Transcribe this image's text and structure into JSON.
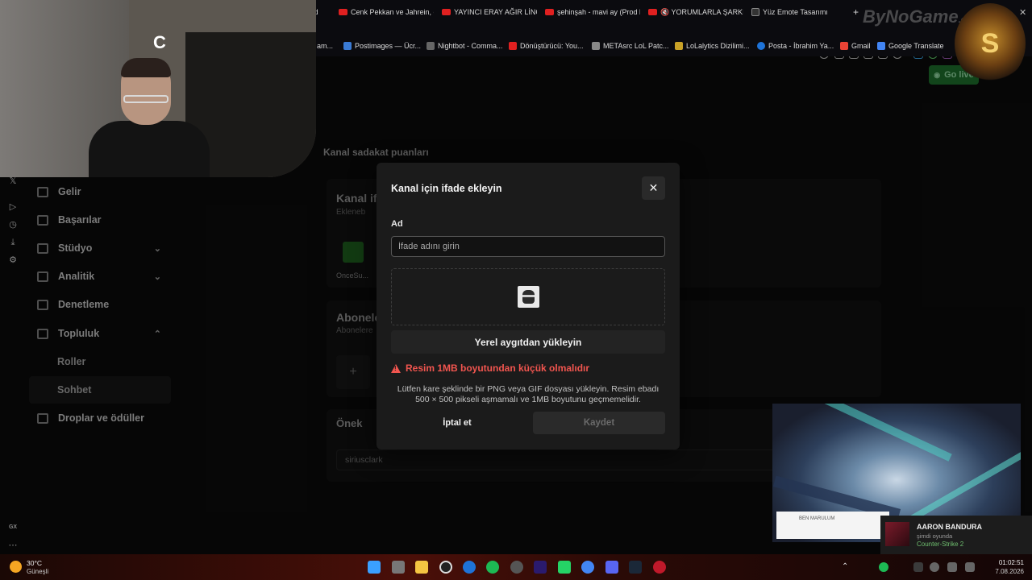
{
  "browser": {
    "tabs": [
      {
        "label": "shboard",
        "icon": "dashboard-tab-icon"
      },
      {
        "label": "Cenk Pekkan ve Jahrein, ca",
        "icon": "youtube-icon"
      },
      {
        "label": "YAYINCI ERAY AĞIR LİNÇ Y",
        "icon": "youtube-icon"
      },
      {
        "label": "şehinşah - mavi ay (Prod b",
        "icon": "youtube-icon"
      },
      {
        "label": "🔇 YORUMLARLA ŞARKI Y",
        "icon": "youtube-icon"
      },
      {
        "label": "Yüz Emote Tasarımı",
        "icon": "openai-icon"
      }
    ],
    "new_tab": "+",
    "bookmarks": [
      {
        "label": "am...",
        "icon": "bookmark-icon"
      },
      {
        "label": "Postimages — Ücr...",
        "icon": "postimages-icon"
      },
      {
        "label": "Nightbot - Comma...",
        "icon": "nightbot-icon"
      },
      {
        "label": "Dönüştürücü: You...",
        "icon": "youtube-icon"
      },
      {
        "label": "METAsrc LoL Patc...",
        "icon": "metasrc-icon"
      },
      {
        "label": "LoLalytics Dizilimi...",
        "icon": "lolalytics-icon"
      },
      {
        "label": "Posta - İbrahim Ya...",
        "icon": "outlook-icon"
      },
      {
        "label": "Gmail",
        "icon": "gmail-icon"
      },
      {
        "label": "Google Translate",
        "icon": "translate-icon"
      }
    ],
    "brand_watermark": "ByNoGame",
    "brand_sub": ".com"
  },
  "header": {
    "go_live": "Go live"
  },
  "page": {
    "section_title": "Kanal sadakat puanları",
    "card1_title": "Kanal ifa",
    "card1_sub": "Ekleneb",
    "emote_name": "OnceSu...",
    "card2_title": "Abonele",
    "card2_sub": "Abonelere",
    "add_symbol": "+",
    "prefix_title": "Önek",
    "prefix_value": "siriusclark"
  },
  "sidebar": {
    "items": [
      {
        "label": "Gelir",
        "icon": "revenue-icon"
      },
      {
        "label": "Başarılar",
        "icon": "achievements-icon"
      },
      {
        "label": "Stüdyo",
        "icon": "studio-icon",
        "chevron": "⌄"
      },
      {
        "label": "Analitik",
        "icon": "analytics-icon",
        "chevron": "⌄"
      },
      {
        "label": "Denetleme",
        "icon": "moderation-icon"
      },
      {
        "label": "Topluluk",
        "icon": "community-icon",
        "chevron": "⌃"
      }
    ],
    "sub_items": [
      {
        "label": "Roller"
      },
      {
        "label": "Sohbet"
      }
    ],
    "drops": {
      "label": "Droplar ve ödüller",
      "icon": "drops-icon"
    }
  },
  "modal": {
    "title": "Kanal için ifade ekleyin",
    "close": "✕",
    "name_label": "Ad",
    "name_placeholder": "İfade adını girin",
    "name_value": "",
    "upload_button": "Yerel aygıtdan yükleyin",
    "error": "Resim 1MB boyutundan küçük olmalıdır",
    "help_line1": "Lütfen kare şeklinde bir PNG veya GIF dosyası yükleyin. Resim ebadı",
    "help_line2": "500 × 500 pikseli aşmamalı ve 1MB boyutunu geçmemelidir.",
    "cancel": "İptal et",
    "save": "Kaydet"
  },
  "overlay": {
    "game_caption": "BEN MARULUM",
    "notif_name": "AARON BANDURA",
    "notif_status": "şimdi oyunda",
    "notif_game": "Counter-Strike 2"
  },
  "taskbar": {
    "weather_temp": "30°C",
    "weather_desc": "Güneşli",
    "time": "01:02:51",
    "date": "7.08.2026",
    "gx_label": "GX"
  },
  "colors": {
    "accent_green": "#1d6b2a",
    "error": "#f1554f",
    "modal_bg": "#1b1b1b"
  }
}
